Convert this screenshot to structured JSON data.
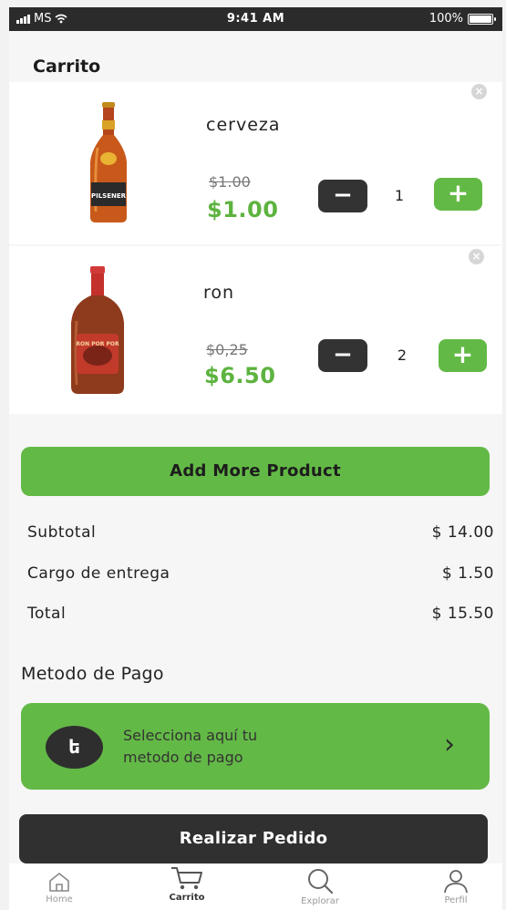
{
  "status_bar": {
    "carrier": "MS",
    "time": "9:41 AM",
    "battery": "100%"
  },
  "header": {
    "title": "Carrito"
  },
  "cart_items": [
    {
      "name": "cerveza",
      "old_price": "$1.00",
      "price": "$1.00",
      "quantity": "1",
      "image_icon": "beer-bottle-icon",
      "brand_label": "PILSENER"
    },
    {
      "name": "ron",
      "old_price": "$0,25",
      "price": "$6.50",
      "quantity": "2",
      "image_icon": "rum-bottle-icon",
      "brand_label": "RON POR POR"
    }
  ],
  "controls": {
    "minus": "−",
    "plus": "+",
    "remove": "×"
  },
  "actions": {
    "add_more": "Add More Product",
    "place_order": "Realizar Pedido"
  },
  "summary": {
    "subtotal_label": "Subtotal",
    "subtotal_value": "$ 14.00",
    "delivery_label": "Cargo de entrega",
    "delivery_value": "$ 1.50",
    "total_label": "Total",
    "total_value": "$ 15.50"
  },
  "payment": {
    "section_title": "Metodo de Pago",
    "line1": "Selecciona aquí tu",
    "line2": "metodo de pago",
    "icon_symbol": "ե",
    "chevron": "›"
  },
  "tabbar": [
    {
      "label": "Home",
      "icon": "home-icon"
    },
    {
      "label": "Carrito",
      "icon": "cart-icon",
      "active": true
    },
    {
      "label": "Explorar",
      "icon": "search-icon"
    },
    {
      "label": "Perfil",
      "icon": "user-icon"
    }
  ],
  "colors": {
    "accent": "#63b946",
    "price": "#5db33f",
    "dark": "#303030",
    "background": "#f6f6f6"
  }
}
